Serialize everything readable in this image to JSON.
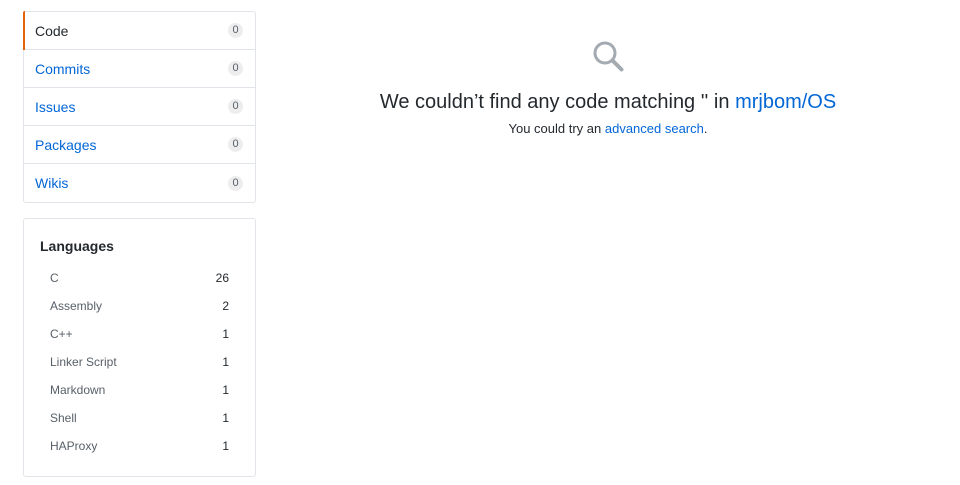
{
  "nav": {
    "items": [
      {
        "label": "Code",
        "count": "0",
        "selected": true
      },
      {
        "label": "Commits",
        "count": "0"
      },
      {
        "label": "Issues",
        "count": "0"
      },
      {
        "label": "Packages",
        "count": "0"
      },
      {
        "label": "Wikis",
        "count": "0"
      }
    ]
  },
  "languages": {
    "title": "Languages",
    "items": [
      {
        "name": "C",
        "count": "26"
      },
      {
        "name": "Assembly",
        "count": "2"
      },
      {
        "name": "C++",
        "count": "1"
      },
      {
        "name": "Linker Script",
        "count": "1"
      },
      {
        "name": "Markdown",
        "count": "1"
      },
      {
        "name": "Shell",
        "count": "1"
      },
      {
        "name": "HAProxy",
        "count": "1"
      }
    ]
  },
  "blankslate": {
    "icon": "search-icon",
    "title_prefix": "We couldn’t find any code matching '' in ",
    "repo_link": "mrjbom/OS",
    "sub_prefix": "You could try an ",
    "sub_link": "advanced search",
    "sub_suffix": "."
  },
  "colors": {
    "link": "#0366d6",
    "selected_accent": "#e36209",
    "border": "#e1e4e8"
  }
}
